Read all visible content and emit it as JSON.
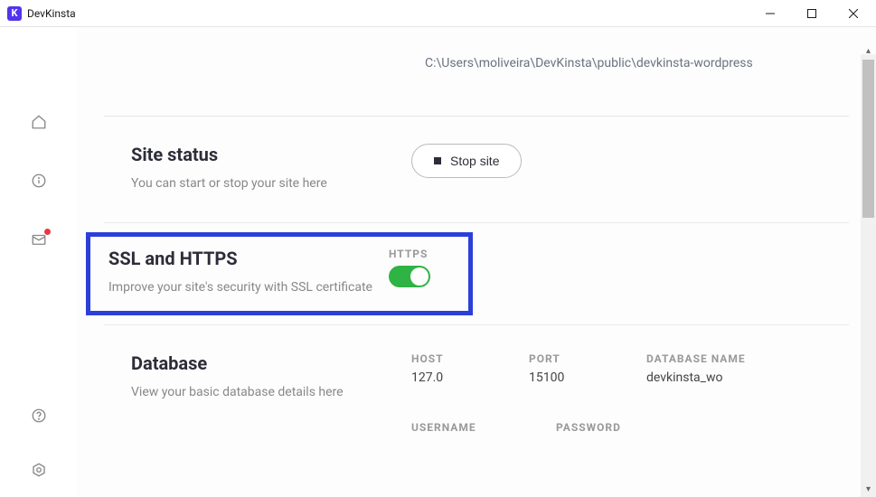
{
  "window": {
    "title": "DevKinsta"
  },
  "path": "C:\\Users\\moliveira\\DevKinsta\\public\\devkinsta-wordpress",
  "siteStatus": {
    "title": "Site status",
    "desc": "You can start or stop your site here",
    "button": "Stop site"
  },
  "ssl": {
    "title": "SSL and HTTPS",
    "desc": "Improve your site's security with SSL certificate",
    "toggleLabel": "HTTPS"
  },
  "database": {
    "title": "Database",
    "desc": "View your basic database details here",
    "hostLabel": "HOST",
    "hostValue": "127.0",
    "portLabel": "PORT",
    "portValue": "15100",
    "nameLabel": "DATABASE NAME",
    "nameValue": "devkinsta_wo",
    "usernameLabel": "USERNAME",
    "passwordLabel": "PASSWORD"
  }
}
